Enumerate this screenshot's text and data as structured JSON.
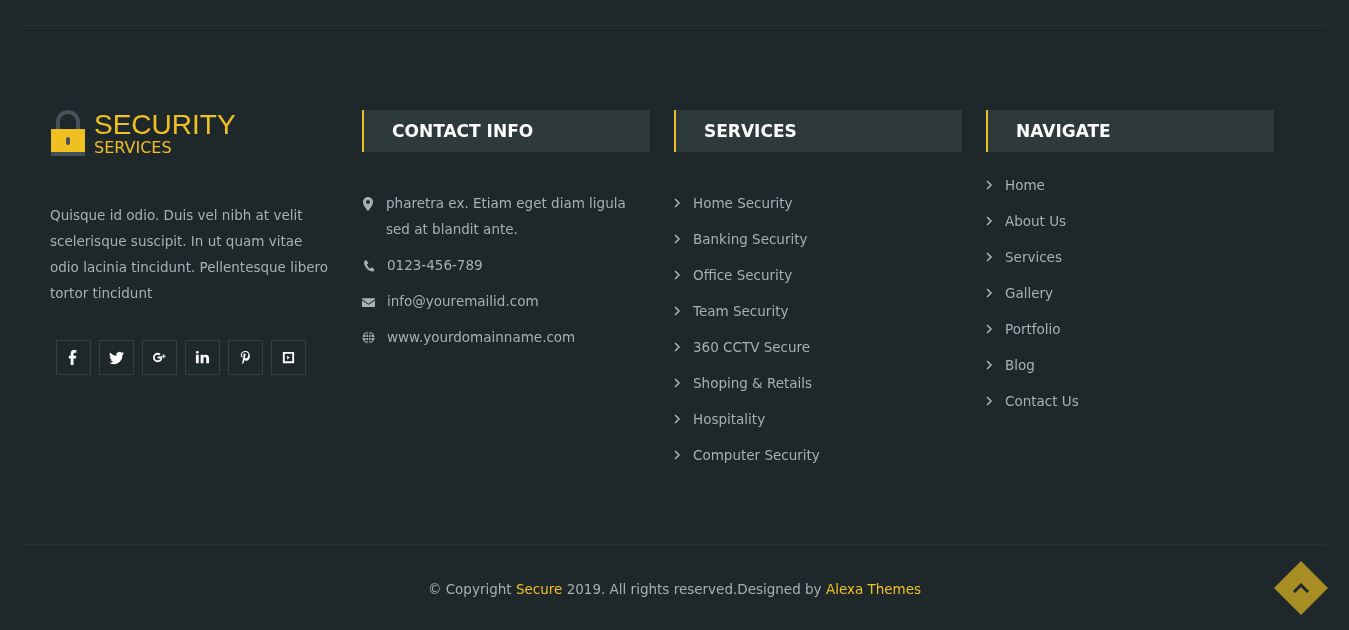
{
  "brand": {
    "title": "SECURITY",
    "subtitle": "SERVICES"
  },
  "about": "Quisque id odio. Duis vel nibh at velit scelerisque suscipit. In ut quam vitae odio lacinia tincidunt. Pellentesque libero tortor tincidunt",
  "social": [
    {
      "kind": "facebook"
    },
    {
      "kind": "twitter"
    },
    {
      "kind": "google-plus"
    },
    {
      "kind": "linkedin"
    },
    {
      "kind": "pinterest"
    },
    {
      "kind": "video"
    }
  ],
  "contact": {
    "heading": "CONTACT INFO",
    "items": [
      {
        "kind": "address",
        "text": "pharetra ex. Etiam eget diam ligula sed at blandit ante."
      },
      {
        "kind": "phone",
        "text": "0123-456-789"
      },
      {
        "kind": "email",
        "text": "info@youremailid.com"
      },
      {
        "kind": "web",
        "text": "www.yourdomainname.com"
      }
    ]
  },
  "services": {
    "heading": "SERVICES",
    "items": [
      "Home Security",
      "Banking Security",
      "Office Security",
      "Team Security",
      "360 CCTV Secure",
      "Shoping & Retails",
      "Hospitality",
      "Computer Security"
    ]
  },
  "navigate": {
    "heading": "NAVIGATE",
    "items": [
      "Home",
      "About Us",
      "Services",
      "Gallery",
      "Portfolio",
      "Blog",
      "Contact Us"
    ]
  },
  "copyright": [
    {
      "kind": "text",
      "text": "© Copyright "
    },
    {
      "kind": "link",
      "text": "Secure"
    },
    {
      "kind": "text",
      "text": " 2019. All rights reserved.Designed by "
    },
    {
      "kind": "link",
      "text": "Alexa Themes"
    }
  ]
}
